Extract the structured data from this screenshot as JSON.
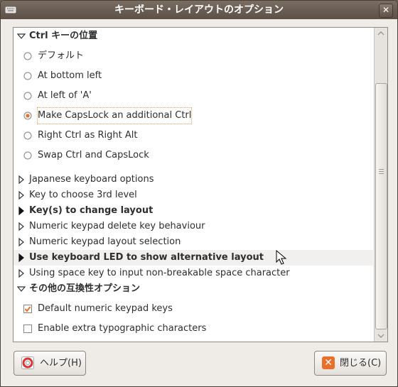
{
  "window": {
    "title": "キーボード・レイアウトのオプション"
  },
  "tree": {
    "group1": {
      "label": "Ctrl キーの位置",
      "options": [
        {
          "label": "デフォルト",
          "selected": false
        },
        {
          "label": "At bottom left",
          "selected": false
        },
        {
          "label": "At left of 'A'",
          "selected": false
        },
        {
          "label": "Make CapsLock an additional Ctrl",
          "selected": true
        },
        {
          "label": "Right Ctrl as Right Alt",
          "selected": false
        },
        {
          "label": "Swap Ctrl and CapsLock",
          "selected": false
        }
      ]
    },
    "collapsed": [
      {
        "label": "Japanese keyboard options",
        "bold": false
      },
      {
        "label": "Key to choose 3rd level",
        "bold": false
      },
      {
        "label": "Key(s) to change layout",
        "bold": true
      },
      {
        "label": "Numeric keypad delete key behaviour",
        "bold": false
      },
      {
        "label": "Numeric keypad layout selection",
        "bold": false
      },
      {
        "label": "Use keyboard LED to show alternative layout",
        "bold": true
      },
      {
        "label": "Using space key to input non-breakable space character",
        "bold": false
      }
    ],
    "group2": {
      "label": "その他の互換性オプション",
      "options": [
        {
          "label": "Default numeric keypad keys",
          "checked": true
        },
        {
          "label": "Enable extra typographic characters",
          "checked": false
        }
      ]
    }
  },
  "buttons": {
    "help": "ヘルプ(H)",
    "close": "閉じる(C)"
  },
  "colors": {
    "accent": "#e8702a",
    "titlebar": "#6b5f55"
  },
  "icons": {
    "help": "help-lifebuoy-icon",
    "close": "close-x-icon"
  }
}
